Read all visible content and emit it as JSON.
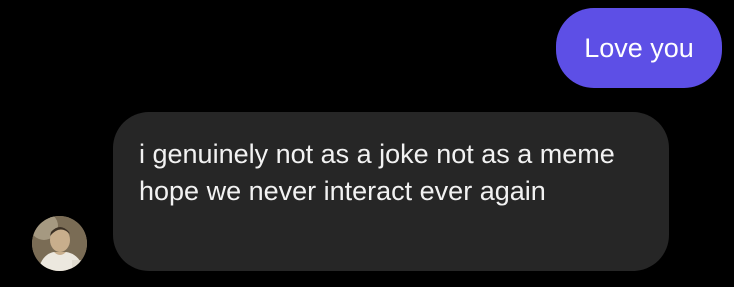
{
  "thread": {
    "messages": [
      {
        "direction": "outgoing",
        "text": "Love you"
      },
      {
        "direction": "incoming",
        "text": "i genuinely not as a joke not as a meme hope we never interact ever again",
        "sender_avatar": "user-avatar-photo"
      }
    ]
  },
  "colors": {
    "background": "#000000",
    "outgoing_bubble": "#5d4fe6",
    "incoming_bubble": "#262626",
    "text": "#ffffff"
  }
}
